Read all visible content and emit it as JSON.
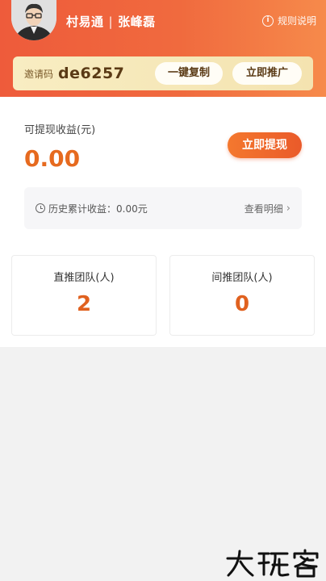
{
  "header": {
    "app_name": "村易通",
    "separator": "|",
    "user_name": "张峰磊",
    "rules_label": "规则说明",
    "rules_icon": "info-circle-icon"
  },
  "invite": {
    "label": "邀请码",
    "code": "de6257",
    "copy_button": "一键复制",
    "promote_button": "立即推广"
  },
  "earnings": {
    "withdrawable_label": "可提现收益(元)",
    "withdrawable_value": "0.00",
    "withdraw_button": "立即提现",
    "history_label": "历史累计收益：0.00元",
    "history_icon": "clock-icon",
    "detail_link": "查看明细",
    "detail_chevron": "›"
  },
  "teams": {
    "direct": {
      "label": "直推团队(人)",
      "value": "2"
    },
    "indirect": {
      "label": "间推团队(人)",
      "value": "0"
    }
  },
  "watermark": {
    "text": "大玩客"
  },
  "colors": {
    "header_gradient_start": "#ee5b3b",
    "header_gradient_end": "#f68a4b",
    "accent": "#e66a1f",
    "invite_bg": "#f6e8b8"
  }
}
